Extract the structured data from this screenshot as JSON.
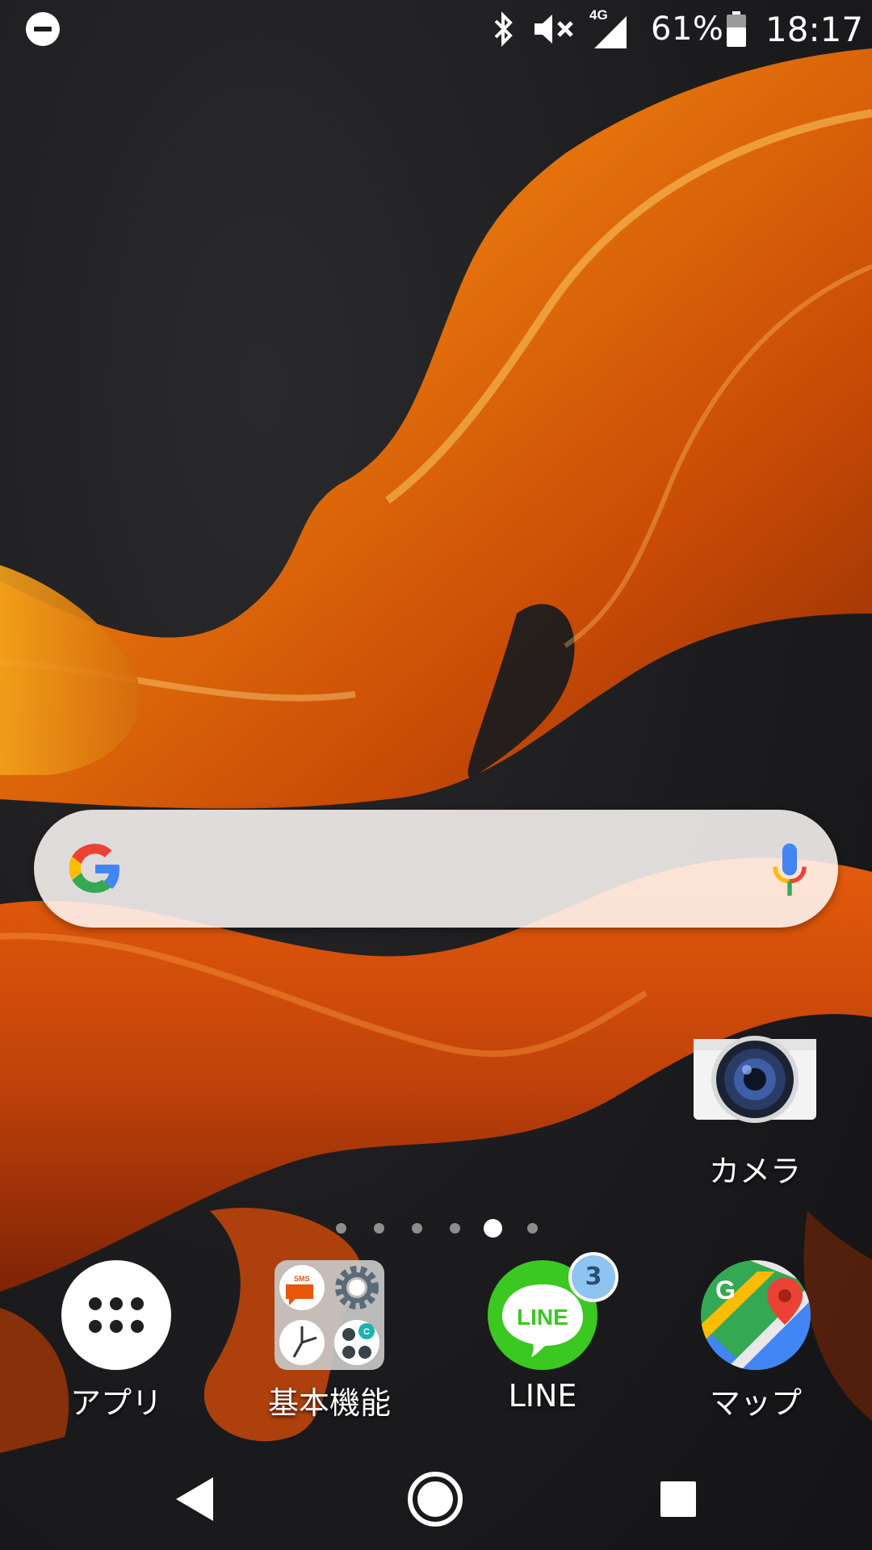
{
  "status_bar": {
    "icons": [
      "do-not-disturb-icon",
      "bluetooth-icon",
      "volume-muted-icon",
      "signal-4g-icon",
      "battery-icon"
    ],
    "network_type": "4G",
    "battery_percent": "61%",
    "battery_level": 0.61,
    "time": "18:17"
  },
  "search_widget": {
    "logo": "google-logo",
    "mic": "mic-icon",
    "placeholder": ""
  },
  "desktop_apps": [
    {
      "label": "カメラ",
      "icon": "camera-icon"
    }
  ],
  "page_indicator": {
    "total_pages": 6,
    "current_page": 5
  },
  "dock": [
    {
      "label": "アプリ",
      "icon": "app-drawer-icon"
    },
    {
      "label": "基本機能",
      "icon": "folder-icon",
      "folder_contents": [
        "sms-icon",
        "settings-icon",
        "clock-icon",
        "calculator-icon"
      ],
      "sms_text": "SMS",
      "calc_text": "C"
    },
    {
      "label": "LINE",
      "icon": "line-icon",
      "logo_text": "LINE",
      "badge": "3"
    },
    {
      "label": "マップ",
      "icon": "maps-icon",
      "logo_text": "G"
    }
  ],
  "nav_bar": {
    "buttons": [
      "back-icon",
      "home-icon",
      "recents-icon"
    ]
  },
  "colors": {
    "wallpaper_dark": "#1c1c1e",
    "wallpaper_orange": "#e8620c",
    "wallpaper_amber": "#f29a0e",
    "line_green": "#3ac821",
    "badge_blue": "#8fc3f0",
    "maps_green": "#35a853",
    "maps_blue": "#4285f4",
    "maps_red": "#ea4335",
    "maps_yellow": "#fbbc04"
  }
}
